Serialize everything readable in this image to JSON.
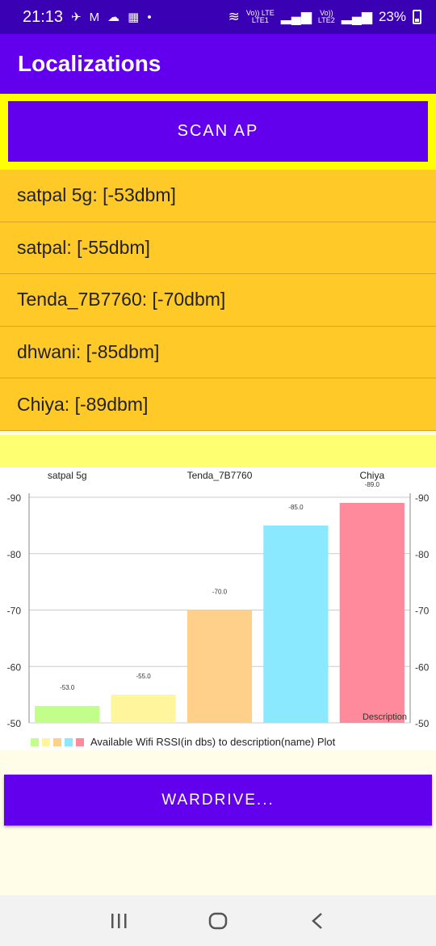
{
  "status": {
    "time": "21:13",
    "battery": "23%",
    "net1_top": "Vo)) LTE",
    "net1_bottom": "LTE1",
    "net2_top": "Vo))",
    "net2_bottom": "LTE2"
  },
  "app_bar": {
    "title": "Localizations"
  },
  "scan_button": {
    "label": "SCAN AP"
  },
  "ap_list": [
    {
      "label": "satpal 5g: [-53dbm]"
    },
    {
      "label": "satpal: [-55dbm]"
    },
    {
      "label": "Tenda_7B7760: [-70dbm]"
    },
    {
      "label": "dhwani: [-85dbm]"
    },
    {
      "label": "Chiya: [-89dbm]"
    }
  ],
  "chart_data": {
    "type": "bar",
    "categories": [
      "satpal 5g",
      "satpal",
      "Tenda_7B7760",
      "dhwani",
      "Chiya"
    ],
    "top_labels": [
      "satpal 5g",
      "",
      "Tenda_7B7760",
      "",
      "Chiya"
    ],
    "values": [
      -53,
      -55,
      -70,
      -85,
      -89
    ],
    "value_labels": [
      "-53.0",
      "-55.0",
      "-70.0",
      "-85.0",
      "-89.0"
    ],
    "colors": [
      "#c1ff8a",
      "#fff59d",
      "#ffd08a",
      "#8ae8ff",
      "#ff8a9b"
    ],
    "y_ticks": [
      -90,
      -80,
      -70,
      -60,
      -50
    ],
    "ylim": [
      -50,
      -90
    ],
    "description": "Description",
    "legend_label": "Available Wifi RSSI(in dbs) to description(name) Plot",
    "grid": true
  },
  "wardrive_button": {
    "label": "WARDRIVE..."
  },
  "nav": {
    "recents_icon": "recents-icon",
    "home_icon": "home-icon",
    "back_icon": "back-icon"
  }
}
